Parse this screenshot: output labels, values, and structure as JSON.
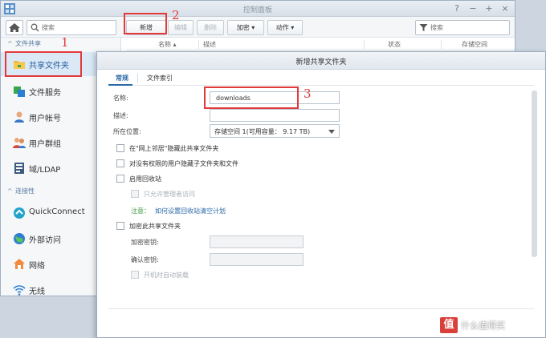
{
  "window": {
    "title": "控制面板"
  },
  "toolbar": {
    "search_placeholder": "搜索",
    "buttons": {
      "create": "新增",
      "edit": "编辑",
      "delete": "删除",
      "encrypt": "加密 ▾",
      "action": "动作 ▾"
    },
    "list_search_placeholder": "搜索"
  },
  "sidebar": {
    "section_file_sharing": "文件共享",
    "section_connectivity": "连接性",
    "items": [
      {
        "label": "共享文件夹",
        "icon": "shared-folder-icon",
        "active": true
      },
      {
        "label": "文件服务",
        "icon": "file-services-icon",
        "active": false
      },
      {
        "label": "用户帐号",
        "icon": "user-icon",
        "active": false
      },
      {
        "label": "用户群组",
        "icon": "group-icon",
        "active": false
      },
      {
        "label": "域/LDAP",
        "icon": "domain-icon",
        "active": false
      },
      {
        "label": "QuickConnect",
        "icon": "quickconnect-icon",
        "active": false
      },
      {
        "label": "外部访问",
        "icon": "globe-icon",
        "active": false
      },
      {
        "label": "网络",
        "icon": "network-icon",
        "active": false
      },
      {
        "label": "无线",
        "icon": "wifi-icon",
        "active": false
      }
    ]
  },
  "table": {
    "columns": [
      "名称 ▴",
      "描述",
      "状态",
      "存储空间"
    ]
  },
  "annotations": [
    "1",
    "2",
    "3"
  ],
  "dialog": {
    "title": "新增共享文件夹",
    "tabs": [
      "常规",
      "文件索引"
    ],
    "fields": {
      "name_label": "名称:",
      "name_value": "downloads",
      "description_label": "描述:",
      "description_value": "",
      "location_label": "所在位置:",
      "location_value": "存储空间 1(可用容量： 9.17 TB)"
    },
    "checkboxes": {
      "hide_network": "在\"网上邻居\"隐藏此共享文件夹",
      "hide_no_permission": "对没有权限的用户隐藏子文件夹和文件",
      "enable_recycle": "启用回收站",
      "admin_only": "只允许管理者访问",
      "encrypt": "加密此共享文件夹",
      "auto_mount": "开机时自动装载"
    },
    "note_label": "注意：",
    "note_link": "如何设置回收站清空计划",
    "encryption": {
      "key_label": "加密密钥:",
      "confirm_label": "确认密钥:"
    }
  },
  "watermark": {
    "badge": "值",
    "text": "什么值得买"
  },
  "colors": {
    "accent": "#2a68a8",
    "annotation_red": "#e23a3a",
    "active_item_bg": "#dbe9f7"
  }
}
